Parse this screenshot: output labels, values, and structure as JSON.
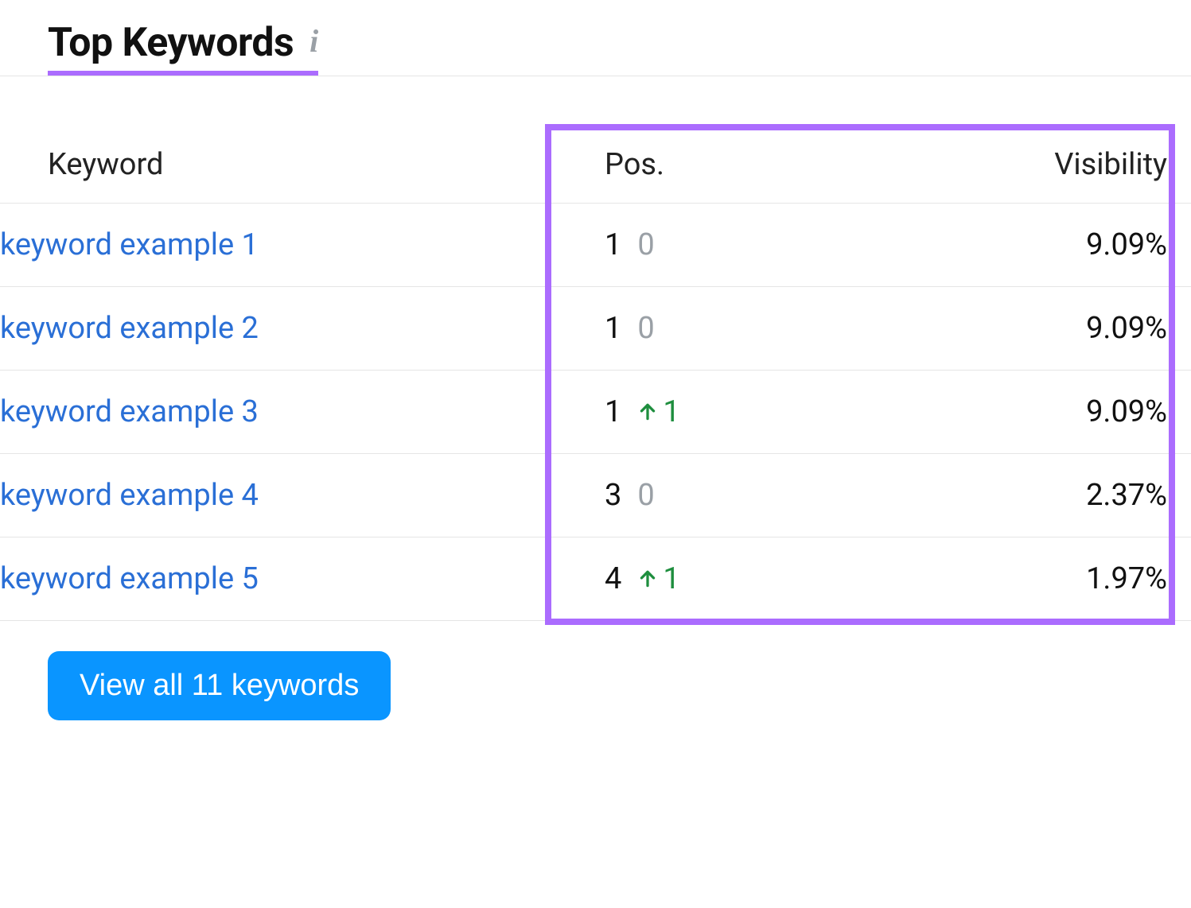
{
  "title": "Top Keywords",
  "columns": {
    "keyword": "Keyword",
    "position": "Pos.",
    "visibility": "Visibility"
  },
  "rows": [
    {
      "keyword": "keyword example 1",
      "position": "1",
      "delta_type": "zero",
      "delta": "0",
      "visibility": "9.09%"
    },
    {
      "keyword": "keyword example 2",
      "position": "1",
      "delta_type": "zero",
      "delta": "0",
      "visibility": "9.09%"
    },
    {
      "keyword": "keyword example 3",
      "position": "1",
      "delta_type": "up",
      "delta": "1",
      "visibility": "9.09%"
    },
    {
      "keyword": "keyword example 4",
      "position": "3",
      "delta_type": "zero",
      "delta": "0",
      "visibility": "2.37%"
    },
    {
      "keyword": "keyword example 5",
      "position": "4",
      "delta_type": "up",
      "delta": "1",
      "visibility": "1.97%"
    }
  ],
  "viewall": "View all 11 keywords"
}
